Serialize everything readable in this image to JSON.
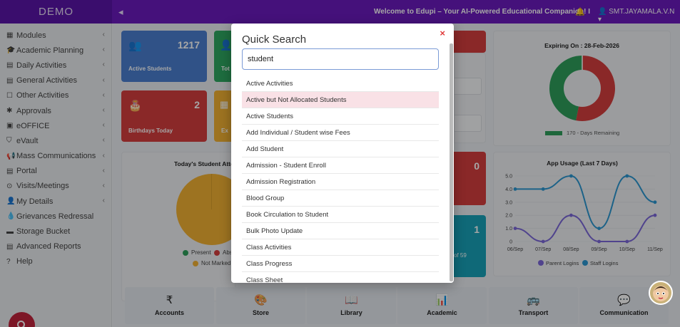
{
  "header": {
    "brand": "DEMO",
    "toggle": "◂",
    "welcome": "Welcome to Edupi – Your AI-Powered Educational Companion! I",
    "bell": "🔔",
    "user": "👤 SMT.JAYAMALA.V.N ▾"
  },
  "sidebar": {
    "items": [
      {
        "icon": "▦",
        "label": "Modules",
        "chevron": "‹"
      },
      {
        "icon": "🎓",
        "label": "Academic Planning",
        "chevron": "‹"
      },
      {
        "icon": "▤",
        "label": "Daily Activities",
        "chevron": "‹"
      },
      {
        "icon": "▤",
        "label": "General Activities",
        "chevron": "‹"
      },
      {
        "icon": "☐",
        "label": "Other Activities",
        "chevron": "‹"
      },
      {
        "icon": "✱",
        "label": "Approvals",
        "chevron": "‹"
      },
      {
        "icon": "▣",
        "label": "eOFFICE",
        "chevron": "‹"
      },
      {
        "icon": "⛉",
        "label": "eVault",
        "chevron": "‹"
      },
      {
        "icon": "📢",
        "label": "Mass Communications",
        "chevron": "‹"
      },
      {
        "icon": "▤",
        "label": "Portal",
        "chevron": "‹"
      },
      {
        "icon": "⊙",
        "label": "Visits/Meetings",
        "chevron": "‹"
      },
      {
        "icon": "👤",
        "label": "My Details",
        "chevron": "‹"
      },
      {
        "icon": "💧",
        "label": "Grievances Redressal",
        "chevron": ""
      },
      {
        "icon": "▬",
        "label": "Storage Bucket",
        "chevron": ""
      },
      {
        "icon": "▤",
        "label": "Advanced Reports",
        "chevron": ""
      },
      {
        "icon": "?",
        "label": "Help",
        "chevron": ""
      }
    ]
  },
  "cards": {
    "students_count": "1217",
    "students_label": "Active Students",
    "birthdays_count": "2",
    "birthdays_label": "Birthdays Today",
    "teal_count": "0",
    "cyan_count": "1",
    "cyan_sub": "of 59",
    "tot_label": "Tot",
    "exp_label": "Ex"
  },
  "expiry": {
    "title": "Expiring On : 28-Feb-2026",
    "legend": "170 - Days Remaining",
    "remaining_pct": 47,
    "colors": {
      "remaining": "#2e9e5b",
      "used": "#d43e3e"
    }
  },
  "attendance": {
    "title": "Today's Student Atter",
    "legend": [
      {
        "label": "Present",
        "color": "#2e9e5b"
      },
      {
        "label": "Abs",
        "color": "#d43e3e"
      },
      {
        "label": "Not Marked",
        "color": "#f2b134"
      }
    ]
  },
  "chart_data": {
    "type": "line",
    "title": "App Usage (Last 7 Days)",
    "categories": [
      "06/Sep",
      "07/Sep",
      "08/Sep",
      "09/Sep",
      "10/Sep",
      "11/Sep"
    ],
    "ylim": [
      0,
      5
    ],
    "yticks": [
      "0",
      "1.0",
      "2.0",
      "3.0",
      "4.0",
      "5.0"
    ],
    "series": [
      {
        "name": "Parent Logins",
        "values": [
          1,
          0,
          2,
          0,
          0,
          2
        ],
        "color": "#7b68d9"
      },
      {
        "name": "Staff Logins",
        "values": [
          4,
          4,
          5,
          1,
          5,
          3
        ],
        "color": "#2c97d1"
      }
    ],
    "legend_position": "bottom"
  },
  "tiles": [
    {
      "icon": "₹",
      "label": "Accounts"
    },
    {
      "icon": "🎨",
      "label": "Store"
    },
    {
      "icon": "📖",
      "label": "Library"
    },
    {
      "icon": "📊",
      "label": "Academic"
    },
    {
      "icon": "🚌",
      "label": "Transport"
    },
    {
      "icon": "💬",
      "label": "Communication"
    }
  ],
  "quick_search": {
    "title": "Quick Search",
    "close": "×",
    "query": "student",
    "results": [
      "Active Activities",
      "Active but Not Allocated Students",
      "Active Students",
      "Add Individual / Student wise Fees",
      "Add Student",
      "Admission - Student Enroll",
      "Admission Registration",
      "Blood Group",
      "Book Circulation to Student",
      "Bulk Photo Update",
      "Class Activities",
      "Class Progress",
      "Class Sheet"
    ]
  }
}
